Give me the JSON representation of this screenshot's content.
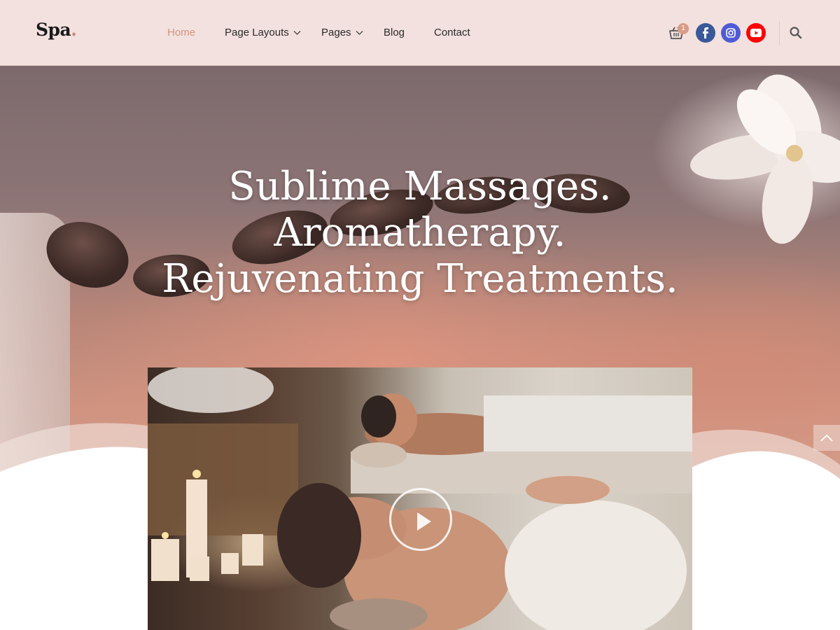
{
  "header": {
    "logo_text": "Spa",
    "logo_dot": ".",
    "nav": [
      {
        "label": "Home",
        "active": true
      },
      {
        "label": "Page Layouts",
        "has_dropdown": true
      },
      {
        "label": "Pages",
        "has_dropdown": true
      },
      {
        "label": "Blog"
      },
      {
        "label": "Contact"
      }
    ],
    "cart_count": "1",
    "social": [
      "facebook-icon",
      "instagram-icon",
      "youtube-icon"
    ]
  },
  "hero": {
    "title_lines": [
      "Sublime Massages.",
      "Aromatherapy.",
      "Rejuvenating Treatments."
    ]
  },
  "colors": {
    "header_bg": "#f2e1df",
    "nav_active": "#d3957f",
    "facebook": "#3b5999",
    "instagram": "#4f5bd5",
    "youtube": "#ff0000"
  }
}
